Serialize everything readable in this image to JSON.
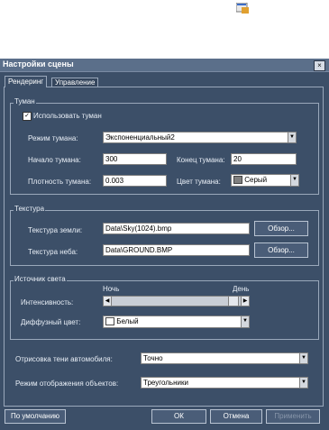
{
  "window": {
    "title": "Настройки сцены",
    "close_glyph": "×"
  },
  "tabs": [
    {
      "label": "Рендеринг"
    },
    {
      "label": "Управление"
    }
  ],
  "fog": {
    "group_title": "Туман",
    "use_fog_label": "Использовать туман",
    "use_fog_checked": true,
    "check_glyph": "✓",
    "mode_label": "Режим тумана:",
    "mode_value": "Экспоненциальный2",
    "start_label": "Начало тумана:",
    "start_value": "300",
    "end_label": "Конец тумана:",
    "end_value": "20",
    "density_label": "Плотность тумана:",
    "density_value": "0.003",
    "color_label": "Цвет тумана:",
    "color_value": "Серый",
    "color_swatch": "#808080"
  },
  "texture": {
    "group_title": "Текстура",
    "ground_label": "Текстура земли:",
    "ground_value": "Data\\Sky(1024).bmp",
    "sky_label": "Текстура неба:",
    "sky_value": "Data\\GROUND.BMP",
    "browse_label": "Обзор..."
  },
  "light": {
    "group_title": "Источник света",
    "night_label": "Ночь",
    "day_label": "День",
    "intensity_label": "Интенсивность:",
    "intensity_level": 0.96,
    "diffuse_label": "Диффузный цвет:",
    "diffuse_value": "Белый",
    "diffuse_swatch": "#ffffff"
  },
  "shadow_label": "Отрисовка тени автомобиля:",
  "shadow_value": "Точно",
  "objects_label": "Режим отображения объектов:",
  "objects_value": "Треугольники",
  "buttons": {
    "defaults": "По умолчанию",
    "ok": "ОК",
    "cancel": "Отмена",
    "apply": "Применить"
  },
  "colors": {
    "window_bg": "#3c4f68",
    "titlebar": "#5b6f8a",
    "border": "#9aa8bb"
  }
}
